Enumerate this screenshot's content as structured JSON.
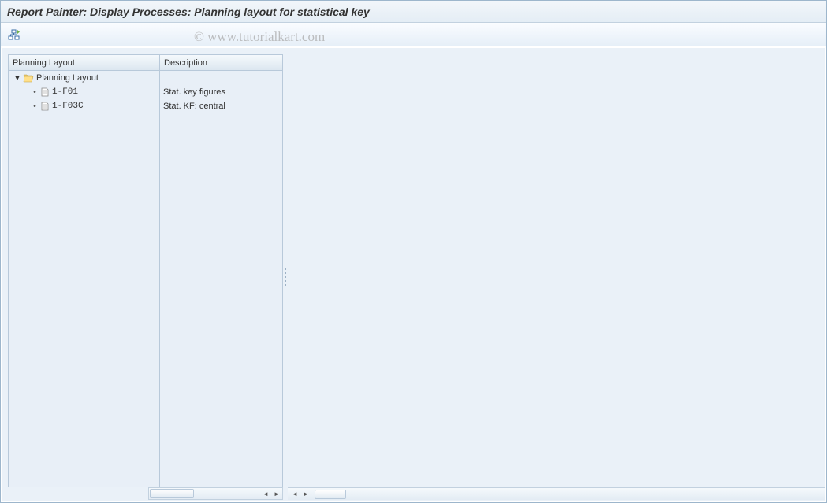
{
  "title": "Report Painter: Display Processes: Planning layout for statistical key",
  "watermark": "© www.tutorialkart.com",
  "columns": {
    "layout": "Planning Layout",
    "description": "Description"
  },
  "tree": {
    "root": {
      "label": "Planning Layout",
      "description": ""
    },
    "items": [
      {
        "code": "1-F01",
        "description": "Stat. key figures"
      },
      {
        "code": "1-F03C",
        "description": "Stat. KF: central"
      }
    ]
  }
}
